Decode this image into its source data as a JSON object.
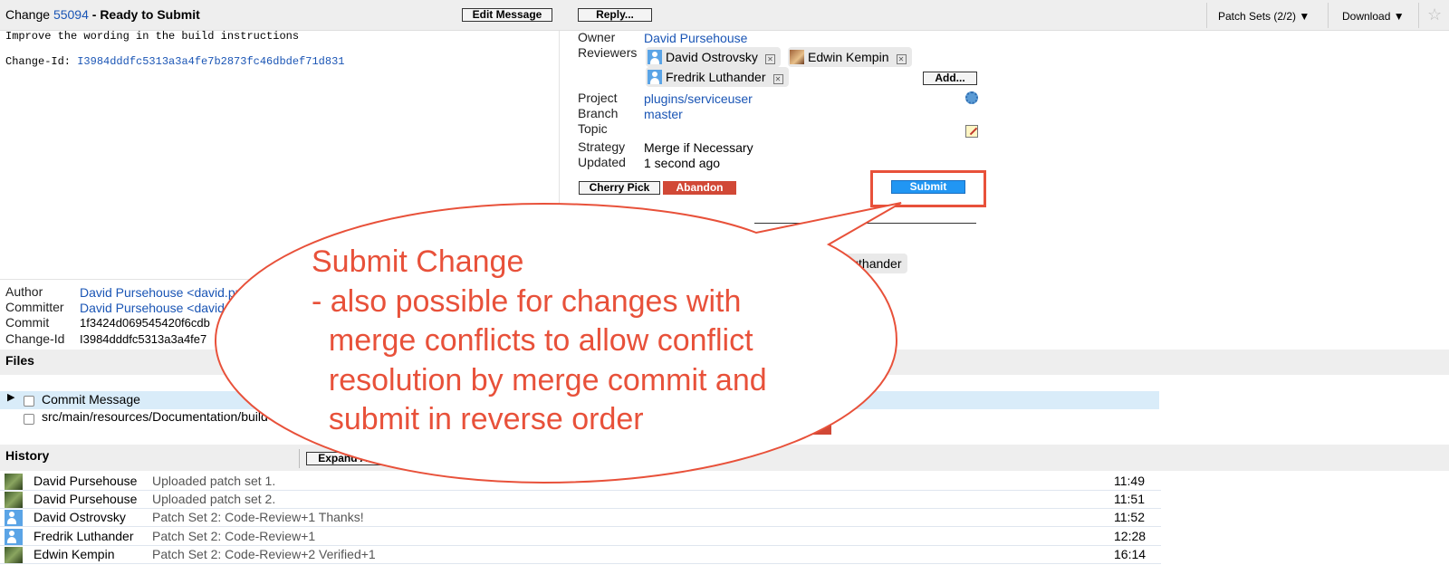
{
  "header": {
    "change_prefix": "Change ",
    "change_number": "55094",
    "change_status": " - Ready to Submit",
    "edit_message": "Edit Message",
    "reply": "Reply...",
    "patch_sets": "Patch Sets (2/2) ▼",
    "download": "Download ▼",
    "star": "☆"
  },
  "commit_message": {
    "subject": "Improve the wording in the build instructions",
    "change_id_label": "Change-Id: ",
    "change_id": "I3984dddfc5313a3a4fe7b2873fc46dbdef71d831"
  },
  "info": {
    "owner_label": "Owner",
    "owner": "David Pursehouse",
    "reviewers_label": "Reviewers",
    "reviewers": [
      "David Ostrovsky",
      "Edwin Kempin",
      "Fredrik Luthander"
    ],
    "add_button": "Add...",
    "project_label": "Project",
    "project": "plugins/serviceuser",
    "branch_label": "Branch",
    "branch": "master",
    "topic_label": "Topic",
    "strategy_label": "Strategy",
    "strategy": "Merge if Necessary",
    "updated_label": "Updated",
    "updated": "1 second ago",
    "cherry_pick": "Cherry Pick",
    "abandon": "Abandon",
    "submit": "Submit",
    "partial_reviewer": "drik Luthander"
  },
  "commit_info": {
    "author_label": "Author",
    "author": "David Pursehouse <david.pu",
    "committer_label": "Committer",
    "committer": "David Pursehouse <david",
    "commit_label": "Commit",
    "commit": "1f3424d069545420f6cdb",
    "change_id_label": "Change-Id",
    "change_id": "I3984dddfc5313a3a4fe7"
  },
  "files": {
    "title": "Files",
    "rows": [
      "Commit Message",
      "src/main/resources/Documentation/build"
    ]
  },
  "history": {
    "title": "History",
    "expand_all": "Expand All",
    "rows": [
      {
        "name": "David Pursehouse",
        "message": "Uploaded patch set 1.",
        "time": "11:49",
        "avatar": "photo-icon"
      },
      {
        "name": "David Pursehouse",
        "message": "Uploaded patch set 2.",
        "time": "11:51",
        "avatar": "photo-icon"
      },
      {
        "name": "David Ostrovsky",
        "message": "Patch Set 2: Code-Review+1 Thanks!",
        "time": "11:52",
        "avatar": "user-icon"
      },
      {
        "name": "Fredrik Luthander",
        "message": "Patch Set 2: Code-Review+1",
        "time": "12:28",
        "avatar": "user-icon"
      },
      {
        "name": "Edwin Kempin",
        "message": "Patch Set 2: Code-Review+2 Verified+1",
        "time": "16:14",
        "avatar": "photo-icon"
      }
    ]
  },
  "callout": {
    "title": "Submit Change",
    "lines": [
      "- also possible for changes with",
      "  merge conflicts to allow conflict",
      "  resolution by merge commit and",
      "  submit in reverse order"
    ],
    "color": "#e8513a"
  }
}
